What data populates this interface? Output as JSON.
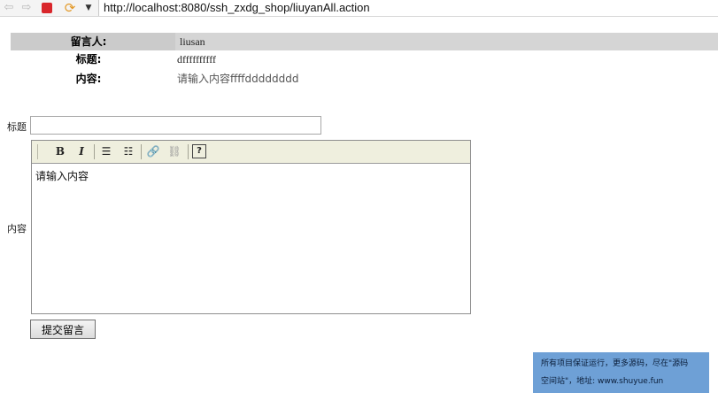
{
  "browser": {
    "url": "http://localhost:8080/ssh_zxdg_shop/liuyanAll.action"
  },
  "message_detail": {
    "author_label": "留言人:",
    "author_value": "liusan",
    "title_label": "标题:",
    "title_value": "dffffffffff",
    "content_label": "内容:",
    "content_value": "请输入内容ffffdddddddd"
  },
  "form": {
    "title_label": "标题",
    "title_value": "",
    "content_label": "内容",
    "editor_text": "请输入内容",
    "toolbar": {
      "bold": "B",
      "italic": "I",
      "ordered_list": "☰",
      "unordered_list": "☷",
      "link": "🔗",
      "unlink": "⛓",
      "help": "?"
    },
    "submit_label": "提交留言"
  },
  "watermark": {
    "line1": "所有项目保证运行，更多源码，尽在\"源码",
    "line2": "空间站\"，地址: www.shuyue.fun"
  }
}
